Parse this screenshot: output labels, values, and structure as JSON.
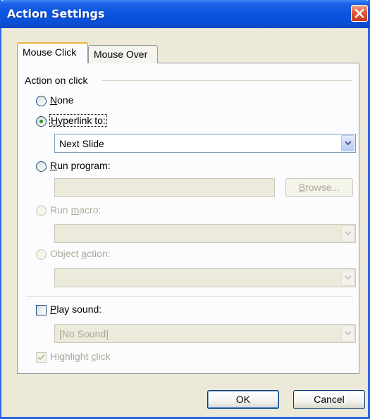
{
  "window": {
    "title": "Action Settings"
  },
  "tabs": [
    {
      "label": "Mouse Click",
      "selected": true
    },
    {
      "label": "Mouse Over",
      "selected": false
    }
  ],
  "section": {
    "title": "Action on click"
  },
  "options": {
    "none": {
      "pre": "",
      "key": "N",
      "post": "one",
      "checked": false,
      "enabled": true
    },
    "hyperlink": {
      "pre": "",
      "key": "H",
      "post": "yperlink to:",
      "checked": true,
      "enabled": true
    },
    "hyperlink_target": "Next Slide",
    "run_program": {
      "pre": "",
      "key": "R",
      "post": "un program:",
      "checked": false,
      "enabled": true
    },
    "browse_button": {
      "pre": "",
      "key": "B",
      "post": "rowse..."
    },
    "run_macro": {
      "pre": "Run ",
      "key": "m",
      "post": "acro:",
      "enabled": false
    },
    "object_action": {
      "pre": "Object ",
      "key": "a",
      "post": "ction:",
      "enabled": false
    }
  },
  "sound": {
    "play": {
      "pre": "",
      "key": "P",
      "post": "lay sound:",
      "checked": false
    },
    "value": "[No Sound]",
    "highlight": {
      "pre": "Highlight ",
      "key": "c",
      "post": "lick",
      "checked": true,
      "enabled": false
    }
  },
  "buttons": {
    "ok": "OK",
    "cancel": "Cancel"
  },
  "colors": {
    "titlebar": "#0a55e0",
    "dialog_bg": "#ece9d8",
    "disabled_text": "#aca899",
    "radio_dot": "#21a121"
  }
}
